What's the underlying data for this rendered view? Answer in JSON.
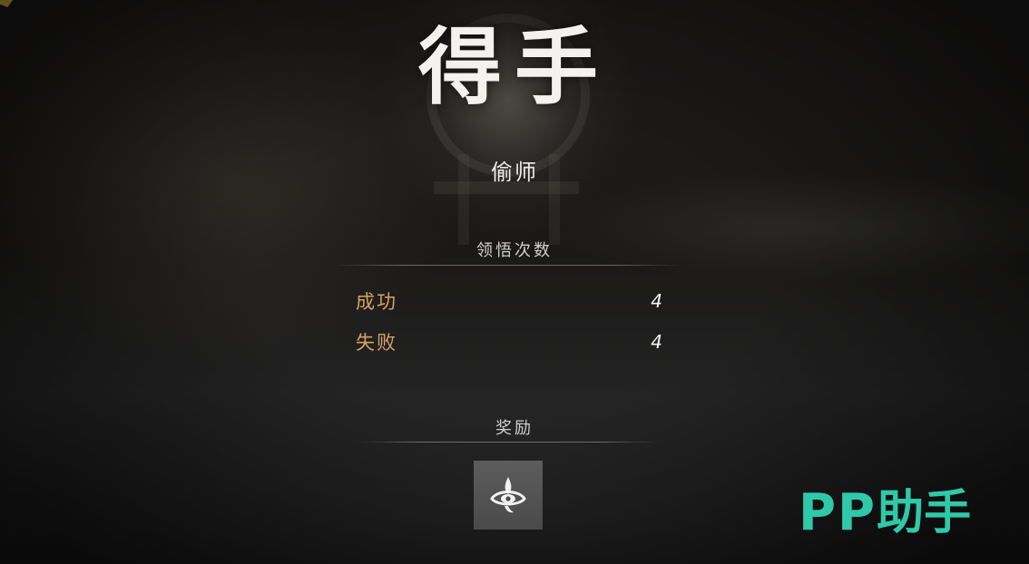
{
  "result": {
    "title": "得手",
    "skill_name": "偷师"
  },
  "attempts": {
    "header": "领悟次数",
    "rows": [
      {
        "label": "成功",
        "value": "4"
      },
      {
        "label": "失败",
        "value": "4"
      }
    ]
  },
  "rewards": {
    "header": "奖励",
    "items": [
      {
        "icon": "insight-emblem-icon"
      }
    ]
  },
  "watermark": {
    "latin": "PP",
    "cjk": "助手"
  },
  "colors": {
    "stat_label": "#d9a064",
    "watermark": "#2ec9a8"
  }
}
